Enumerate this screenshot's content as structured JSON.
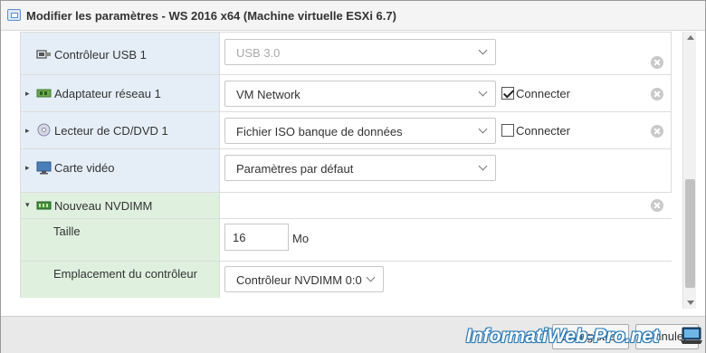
{
  "window": {
    "title": "Modifier les paramètres - WS 2016 x64 (Machine virtuelle ESXi 6.7)"
  },
  "devices": {
    "usb": {
      "label": "Contrôleur USB 1",
      "select_value": "USB 3.0",
      "icon": "usb-icon"
    },
    "network": {
      "label": "Adaptateur réseau 1",
      "select_value": "VM Network",
      "connect_label": "Connecter",
      "connected": true,
      "icon": "network-adapter-icon"
    },
    "cddvd": {
      "label": "Lecteur de CD/DVD 1",
      "select_value": "Fichier ISO banque de données",
      "connect_label": "Connecter",
      "connected": false,
      "icon": "cd-dvd-icon"
    },
    "video": {
      "label": "Carte vidéo",
      "select_value": "Paramètres par défaut",
      "icon": "monitor-icon"
    },
    "nvdimm": {
      "label": "Nouveau NVDIMM",
      "icon": "nvdimm-icon",
      "size_label": "Taille",
      "size_value": "16",
      "size_unit": "Mo",
      "controller_label": "Emplacement du contrôleur",
      "controller_value": "Contrôleur NVDIMM 0:0"
    }
  },
  "footer": {
    "save_label": "Enregistrer",
    "cancel_label": "Annuler"
  },
  "watermark": {
    "text": "InformatiWeb-Pro.net"
  },
  "colors": {
    "row_blue": "#e5eef6",
    "row_green": "#dff0df",
    "brand": "#2d7bb5"
  }
}
